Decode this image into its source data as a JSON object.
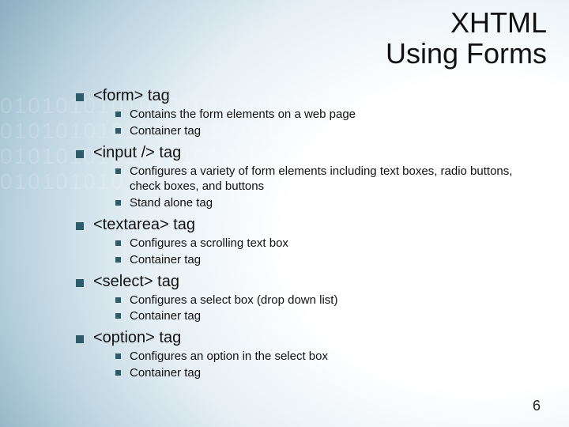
{
  "title_line1": "XHTML",
  "title_line2": "Using Forms",
  "items": [
    {
      "label": "<form> tag",
      "sub": [
        "Contains the form elements on a web page",
        "Container tag"
      ]
    },
    {
      "label": "<input /> tag",
      "sub": [
        "Configures a variety of form elements including text boxes, radio buttons, check boxes, and buttons",
        "Stand alone tag"
      ]
    },
    {
      "label": "<textarea> tag",
      "sub": [
        "Configures a scrolling text box",
        "Container tag"
      ]
    },
    {
      "label": "<select> tag",
      "sub": [
        "Configures a select box (drop down list)",
        "Container tag"
      ]
    },
    {
      "label": "<option> tag",
      "sub": [
        "Configures an option in the select box",
        "Container tag"
      ]
    }
  ],
  "page_number": "6",
  "watermark": "01010101010101010101010101010101010101010101"
}
